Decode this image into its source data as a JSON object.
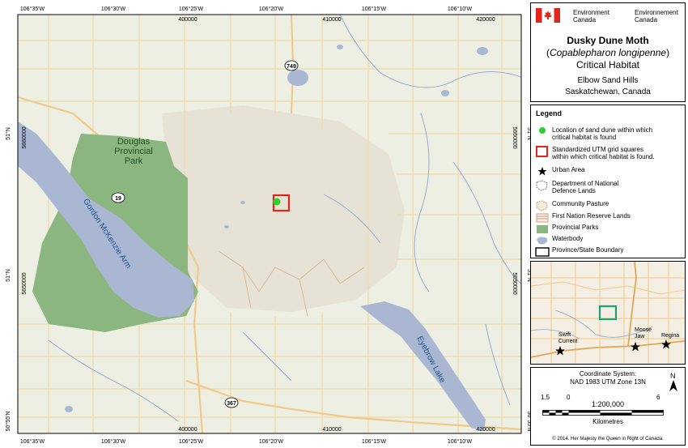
{
  "map": {
    "grid": {
      "top_long_labels": [
        "106°35'W",
        "106°30'W",
        "106°25'W",
        "106°20'W",
        "106°15'W",
        "106°10'W"
      ],
      "bottom_long_labels": [
        "106°35'W",
        "106°30'W",
        "106°25'W",
        "106°20'W",
        "106°15'W",
        "106°10'W"
      ],
      "top_easting_labels": [
        "400000",
        "410000",
        "420000"
      ],
      "bottom_easting_labels": [
        "400000",
        "410000",
        "420000"
      ],
      "left_lat_labels": [
        "51°N",
        "51°N",
        "50°55'N"
      ],
      "right_lat_labels": [
        "51°N",
        "51°N",
        "50°55'N"
      ],
      "left_northing_labels": [
        "5660000",
        "5650000"
      ],
      "right_northing_labels": [
        "5660000",
        "5650000"
      ]
    },
    "labels": {
      "park": "Douglas\nProvincial\nPark",
      "arm": "Gordon McKenzie Arm",
      "lake": "Eyebrow Lake"
    },
    "highways": [
      "749",
      "19",
      "367"
    ]
  },
  "title": {
    "dept_en": "Environment\nCanada",
    "dept_fr": "Environnement\nCanada",
    "species": "Dusky Dune Moth",
    "latin": "Copablepharon longipenne",
    "subtitle": "Critical Habitat",
    "place_line1": "Elbow Sand Hills",
    "place_line2": "Saskatchewan, Canada"
  },
  "legend": {
    "heading": "Legend",
    "items": [
      {
        "label": "Location of sand dune within which\ncritical habitat is found",
        "icon": "green-dot"
      },
      {
        "label": "Standardized UTM grid squares\nwithin which critical habitat is found.",
        "icon": "red-square"
      },
      {
        "label": "Urban Area",
        "icon": "star"
      },
      {
        "label": "Department of National\nDefence Lands",
        "icon": "hatched-area"
      },
      {
        "label": "Community Pasture",
        "icon": "hatched-area"
      },
      {
        "label": "First Nation Reserve Lands",
        "icon": "striped-area"
      },
      {
        "label": "Provincial Parks",
        "icon": "green-area"
      },
      {
        "label": "Waterbody",
        "icon": "blue-area"
      },
      {
        "label": "Province/State Boundary",
        "icon": "boundary-box"
      }
    ]
  },
  "inset": {
    "towns": [
      "Swift\nCurrent",
      "Moose\nJaw",
      "Regina"
    ]
  },
  "info": {
    "coord_line1": "Coordinate System:",
    "coord_line2": "NAD 1983 UTM Zone 13N",
    "north": "N",
    "scale_label": "1:200,000",
    "scale_ticks": [
      "1.5",
      "0",
      "6"
    ],
    "scale_unit": "Kilometres",
    "copyright": "© 2014. Her Majesty the Queen in Right of Canada."
  },
  "colors": {
    "land": "#ecefe2",
    "dune": "#e6e3d6",
    "park": "#8bb67f",
    "water": "#a9b7d3",
    "road": "#f1c98a",
    "stream": "#8fa4cf",
    "habitat": "#e3261c",
    "site": "#2fd12f"
  }
}
